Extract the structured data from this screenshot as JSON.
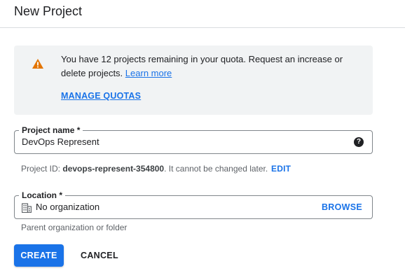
{
  "header": {
    "title": "New Project"
  },
  "quota": {
    "message": "You have 12 projects remaining in your quota. Request an increase or delete projects.",
    "learn_more": "Learn more",
    "manage_quotas": "MANAGE QUOTAS",
    "icon": "warning-icon",
    "icon_color": "#e37400"
  },
  "project_name": {
    "label": "Project name *",
    "value": "DevOps Represent",
    "help_icon": "help-icon"
  },
  "project_id": {
    "prefix": "Project ID: ",
    "id": "devops-represent-354800",
    "suffix": ". It cannot be changed later.",
    "edit": "EDIT"
  },
  "location": {
    "label": "Location *",
    "value": "No organization",
    "browse": "BROWSE",
    "hint": "Parent organization or folder",
    "icon": "organization-icon"
  },
  "actions": {
    "create": "CREATE",
    "cancel": "CANCEL"
  },
  "colors": {
    "accent": "#1a73e8",
    "quota_bg": "#f1f3f4"
  }
}
